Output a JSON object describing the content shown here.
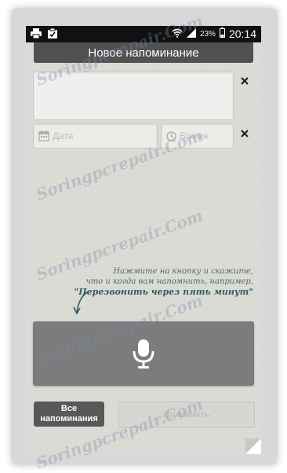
{
  "statusbar": {
    "battery": "23%",
    "time": "20:14"
  },
  "header": {
    "title": "Новое напоминание"
  },
  "form": {
    "date_placeholder": "Дата",
    "time_placeholder": "Время"
  },
  "hint": {
    "line1": "Нажмите на кнопку и скажите,",
    "line2": "что и когда вам напомнить, например,",
    "example": "\"Перезвонить через пять минут\""
  },
  "buttons": {
    "all_line1": "Все",
    "all_line2": "напоминания",
    "save": "Сохранить"
  },
  "watermark": {
    "text": "Soringpcrepair.Com"
  },
  "icons": {
    "print": "print-icon",
    "clipboard": "clipboard-check-icon",
    "wifi": "wifi-icon",
    "signal": "signal-icon",
    "battery": "battery-icon",
    "clear": "close-icon",
    "calendar": "calendar-icon",
    "clock": "clock-icon",
    "mic": "microphone-icon",
    "arrow": "curved-arrow-icon"
  },
  "colors": {
    "title_bar": "#515151",
    "background": "#dcdcd6",
    "mic_button": "#7c7c7c",
    "hint_text": "#4e6b6b"
  }
}
